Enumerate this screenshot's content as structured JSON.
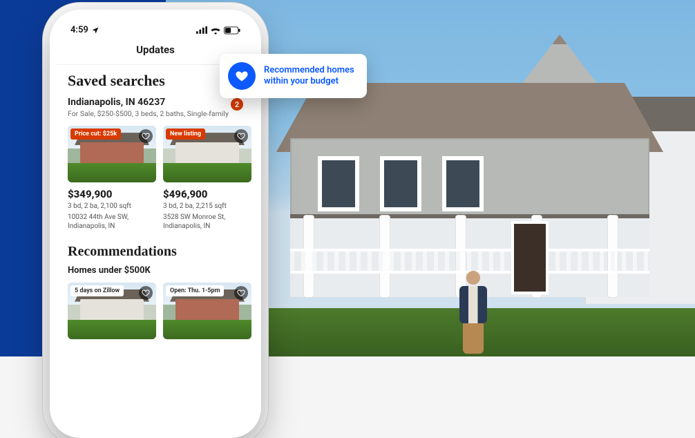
{
  "statusbar": {
    "time": "4:59"
  },
  "header": {
    "title": "Updates"
  },
  "saved": {
    "heading": "Saved searches",
    "title": "Indianapolis, IN 46237",
    "subtitle": "For Sale, $250-$500, 3 beds, 2 baths, Single-family",
    "count": "2",
    "cards": [
      {
        "tag": "Price cut: $25k",
        "price": "$349,900",
        "meta1": "3 bd, 2 ba, 2,100 sqft",
        "meta2": "10032 44th Ave SW, Indianapolis, IN"
      },
      {
        "tag": "New listing",
        "price": "$496,900",
        "meta1": "3 bd, 2 ba, 2,215 sqft",
        "meta2": "3528 SW Monroe St, Indianapolis, IN"
      }
    ]
  },
  "reco": {
    "heading": "Recommendations",
    "subtitle": "Homes under $500K",
    "cards": [
      {
        "tag": "5 days on Zillow"
      },
      {
        "tag": "Open: Thu. 1-5pm"
      }
    ]
  },
  "callout": {
    "line1": "Recommended homes",
    "line2": "within your budget"
  }
}
